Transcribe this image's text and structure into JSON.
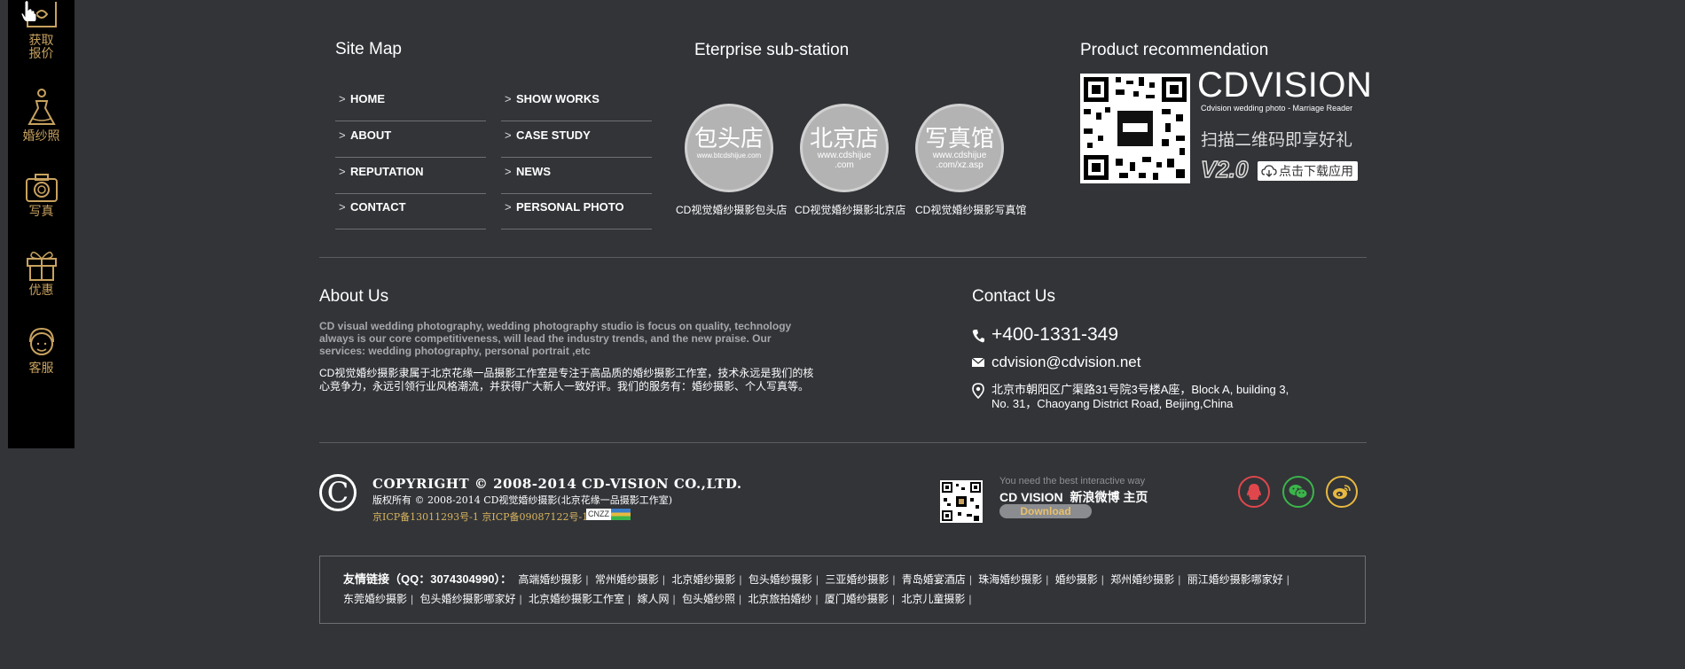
{
  "sidebar": {
    "items": [
      {
        "label": "获取\n报价",
        "icon": "quote-envelope-icon"
      },
      {
        "label": "婚纱照",
        "icon": "wedding-dress-icon"
      },
      {
        "label": "写真",
        "icon": "camera-icon"
      },
      {
        "label": "优惠",
        "icon": "gift-icon"
      },
      {
        "label": "客服",
        "icon": "customer-service-icon"
      }
    ],
    "accent_color": "#c8a25f"
  },
  "sitemap": {
    "title": "Site Map",
    "links": [
      "HOME",
      "SHOW WORKS",
      "ABOUT",
      "CASE STUDY",
      "REPUTATION",
      "NEWS",
      "CONTACT",
      "PERSONAL PHOTO"
    ]
  },
  "substation": {
    "title": "Eterprise sub-station",
    "stations": [
      {
        "name": "包头店",
        "url": "www.btcdshijue.com",
        "caption": "CD视觉婚纱摄影包头店"
      },
      {
        "name": "北京店",
        "url": "www.cdshijue\n.com",
        "caption": "CD视觉婚纱摄影北京店"
      },
      {
        "name": "写真馆",
        "url": "www.cdshijue\n.com/xz.asp",
        "caption": "CD视觉婚纱摄影写真馆"
      }
    ]
  },
  "product": {
    "title": "Product recommendation",
    "brand": "CDVISION",
    "brand_sub": "Cdvision wedding photo - Marriage Reader",
    "scan_text": "扫描二维码即享好礼",
    "version": "V2.0",
    "download_label": "点击下载应用"
  },
  "about": {
    "title": "About Us",
    "text_en": "CD visual wedding photography, wedding photography studio is focus on quality, technology always is our core competitiveness, will lead the industry trends, and the new praise. Our services: wedding photography, personal portrait ,etc",
    "text_cn": "CD视觉婚纱摄影隶属于北京花缘一品摄影工作室是专注于高品质的婚纱摄影工作室，技术永远是我们的核心竞争力，永远引领行业风格潮流，并获得广大新人一致好评。我们的服务有：婚纱摄影、个人写真等。"
  },
  "contact": {
    "title": "Contact Us",
    "phone": "+400-1331-349",
    "email": "cdvision@cdvision.net",
    "address": "北京市朝阳区广渠路31号院3号楼A座，Block A, building 3, No. 31，Chaoyang District Road, Beijing,China"
  },
  "footer": {
    "copyright": "COPYRIGHT © 2008-2014 CD-VISION CO.,LTD.",
    "rights_cn": "版权所有 © 2008-2014 CD视觉婚纱摄影(北京花缘一品摄影工作室)",
    "icp": "京ICP备13011293号-1 京ICP备09087122号-1",
    "cnzz": "CNZZ",
    "interactive_text": "You need the best interactive way",
    "weibo_brand": "CD VISION",
    "weibo_text": "新浪微博 主页",
    "download_btn": "Download",
    "social": [
      {
        "icon": "qq-icon",
        "color": "#e0474c"
      },
      {
        "icon": "wechat-icon",
        "color": "#3bb54a"
      },
      {
        "icon": "weibo-icon",
        "color": "#e8b940"
      }
    ]
  },
  "friend_links": {
    "label": "友情链接（QQ：3074304990）：",
    "line1": [
      "高端婚纱摄影",
      "常州婚纱摄影",
      "北京婚纱摄影",
      "包头婚纱摄影",
      "三亚婚纱摄影",
      "青岛婚宴酒店",
      "珠海婚纱摄影",
      "婚纱摄影",
      "郑州婚纱摄影",
      "丽江婚纱摄影哪家好"
    ],
    "line2": [
      "东莞婚纱摄影",
      "包头婚纱摄影哪家好",
      "北京婚纱摄影工作室",
      "嫁人网",
      "包头婚纱照",
      "北京旅拍婚纱",
      "厦门婚纱摄影",
      "北京儿童摄影"
    ]
  }
}
